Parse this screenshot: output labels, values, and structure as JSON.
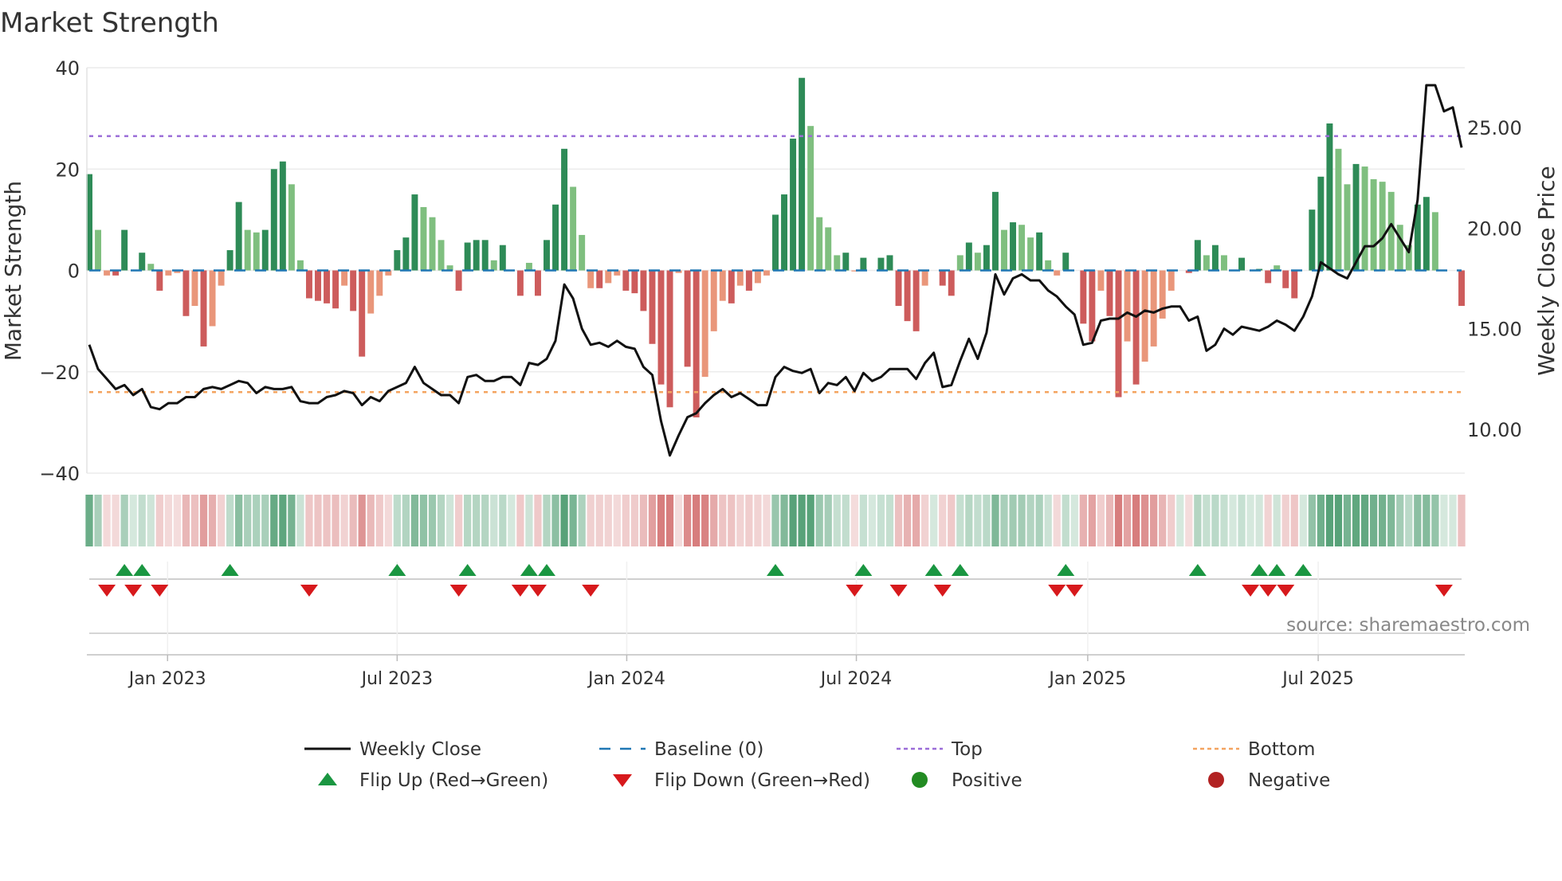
{
  "chart_data": {
    "type": "bar",
    "title": "Market Strength",
    "ylabel": "Market Strength",
    "y2label": "Weekly Close Price",
    "ylim": [
      -40,
      40
    ],
    "y2lim": [
      7.82,
      27.97
    ],
    "yticks": [
      40,
      20,
      0,
      -20,
      -40
    ],
    "yticklabels": [
      "40",
      "20",
      "0",
      "−20",
      "−40"
    ],
    "y2ticks": [
      25,
      20,
      15,
      10
    ],
    "y2ticklabels": [
      "25.00",
      "20.00",
      "15.00",
      "10.00"
    ],
    "x_unit": "week index (week 0 ≈ early Nov 2022)",
    "xticks": [
      {
        "week": 8.9,
        "label": "Jan 2023"
      },
      {
        "week": 35,
        "label": "Jul 2023"
      },
      {
        "week": 61.1,
        "label": "Jan 2024"
      },
      {
        "week": 87.2,
        "label": "Jul 2024"
      },
      {
        "week": 113.5,
        "label": "Jan 2025"
      },
      {
        "week": 139.7,
        "label": "Jul 2025"
      }
    ],
    "top_level": 26.5,
    "bottom_level": -24,
    "strength": [
      19,
      8,
      -1,
      -1,
      8,
      0,
      3.5,
      1.3,
      -4,
      -1,
      -0.5,
      -9,
      -7,
      -15,
      -11,
      -3,
      4,
      13.5,
      8,
      7.5,
      8,
      20,
      21.5,
      17,
      2,
      -5.5,
      -6,
      -6.5,
      -7.5,
      -3,
      -8,
      -17,
      -8.5,
      -5,
      -1,
      4,
      6.5,
      15,
      12.5,
      10.5,
      6,
      1,
      -4,
      5.5,
      6,
      6,
      2,
      5,
      0,
      -5,
      1.5,
      -5,
      6,
      13,
      24,
      16.5,
      7,
      -3.5,
      -3.5,
      -2.5,
      -1,
      -4,
      -4.5,
      -8,
      -14.5,
      -22.5,
      -27,
      -0.5,
      -19,
      -29,
      -21,
      -12,
      -6,
      -6.5,
      -3,
      -4,
      -2.5,
      -1,
      11,
      15,
      26,
      38,
      28.5,
      10.5,
      8.5,
      3,
      3.5,
      -0.2,
      2.5,
      0,
      2.5,
      3,
      -7,
      -10,
      -12,
      -3,
      0,
      -3,
      -5,
      3,
      5.5,
      3.5,
      5,
      15.5,
      8,
      9.5,
      9,
      6.5,
      7.5,
      2,
      -1,
      3.5,
      0,
      -10.5,
      -14,
      -4,
      -9,
      -25,
      -14,
      -22.5,
      -18,
      -15,
      -9.5,
      -4,
      0,
      -0.5,
      6,
      3,
      5,
      3,
      0,
      2.5,
      0,
      0.3,
      -2.5,
      1,
      -3.5,
      -5.5,
      0,
      12,
      18.5,
      29,
      24,
      17,
      21,
      20.5,
      18,
      17.5,
      15.5,
      9,
      5,
      13,
      14.5,
      11.5,
      0,
      0,
      -7
    ],
    "close": [
      14.2,
      13.0,
      12.5,
      12.0,
      12.2,
      11.7,
      12.0,
      11.1,
      11.0,
      11.3,
      11.3,
      11.6,
      11.6,
      12.0,
      12.1,
      12.0,
      12.2,
      12.4,
      12.3,
      11.8,
      12.1,
      12.0,
      12.0,
      12.1,
      11.4,
      11.3,
      11.3,
      11.6,
      11.7,
      11.9,
      11.8,
      11.2,
      11.6,
      11.4,
      11.9,
      12.1,
      12.3,
      13.1,
      12.3,
      12.0,
      11.7,
      11.7,
      11.3,
      12.6,
      12.7,
      12.4,
      12.4,
      12.6,
      12.6,
      12.2,
      13.3,
      13.2,
      13.5,
      14.4,
      17.2,
      16.5,
      15.0,
      14.2,
      14.3,
      14.1,
      14.4,
      14.1,
      14.0,
      13.1,
      12.7,
      10.4,
      8.7,
      9.7,
      10.6,
      10.8,
      11.3,
      11.7,
      12.0,
      11.6,
      11.8,
      11.5,
      11.2,
      11.2,
      12.6,
      13.1,
      12.9,
      12.8,
      13.0,
      11.8,
      12.3,
      12.2,
      12.6,
      11.9,
      12.8,
      12.4,
      12.6,
      13.0,
      13.0,
      13.0,
      12.5,
      13.3,
      13.8,
      12.1,
      12.2,
      13.4,
      14.5,
      13.5,
      14.8,
      17.7,
      16.7,
      17.5,
      17.7,
      17.4,
      17.4,
      16.9,
      16.6,
      16.1,
      15.7,
      14.2,
      14.3,
      15.4,
      15.5,
      15.5,
      15.8,
      15.6,
      15.9,
      15.8,
      16.0,
      16.1,
      16.1,
      15.4,
      15.6,
      13.9,
      14.2,
      15.0,
      14.7,
      15.1,
      15.0,
      14.9,
      15.1,
      15.4,
      15.2,
      14.9,
      15.6,
      16.6,
      18.3,
      18.0,
      17.7,
      17.5,
      18.3,
      19.1,
      19.1,
      19.5,
      20.2,
      19.5,
      18.8,
      21.4,
      27.1,
      27.1,
      25.8,
      26.0,
      24.0
    ],
    "flip_up_weeks": [
      4,
      6,
      16,
      35,
      43,
      50,
      52,
      78,
      88,
      96,
      99,
      111,
      126,
      133,
      135,
      138
    ],
    "flip_down_weeks": [
      2,
      5,
      8,
      25,
      42,
      49,
      51,
      57,
      87,
      92,
      97,
      110,
      112,
      132,
      134,
      136,
      154
    ],
    "legend": [
      {
        "label": "Weekly Close",
        "symbol": "line"
      },
      {
        "label": "Baseline (0)",
        "symbol": "dash"
      },
      {
        "label": "Top",
        "symbol": "dot-purple"
      },
      {
        "label": "Bottom",
        "symbol": "dot-orange"
      },
      {
        "label": "Flip Up (Red→Green)",
        "symbol": "tri-up"
      },
      {
        "label": "Flip Down (Green→Red)",
        "symbol": "tri-down"
      },
      {
        "label": "Positive",
        "symbol": "circle-green"
      },
      {
        "label": "Negative",
        "symbol": "circle-red"
      }
    ],
    "legend_placement": "bottom",
    "source": "source: sharemaestro.com"
  },
  "colors": {
    "pos_strong": "#2e8b57",
    "pos_weak": "#7fbf7f",
    "neg_strong": "#cd5c5c",
    "neg_weak": "#e9967a",
    "top": "#9b6dd8",
    "bottom": "#f4a460",
    "baseline": "#1f77b4",
    "line": "#111111",
    "flip_up": "#1a9641",
    "flip_down": "#d7191c",
    "positive": "#228b22",
    "negative": "#b22222"
  }
}
